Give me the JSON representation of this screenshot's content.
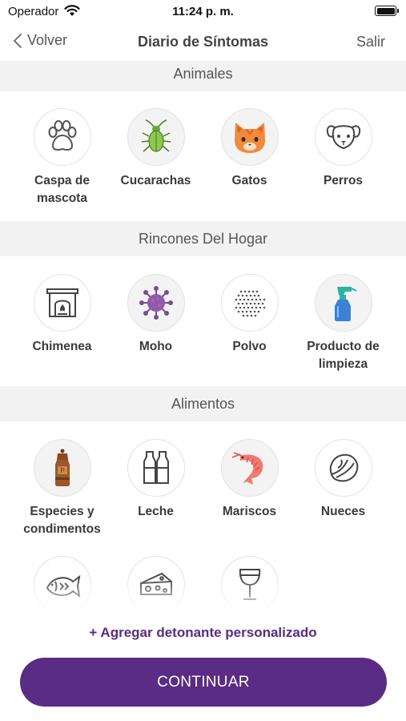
{
  "status": {
    "carrier": "Operador",
    "time": "11:24 p. m."
  },
  "nav": {
    "back_label": "Volver",
    "title": "Diario de Síntomas",
    "exit_label": "Salir"
  },
  "sections": [
    {
      "title": "Animales",
      "items": [
        {
          "label": "Caspa de mascota",
          "icon": "paw-icon"
        },
        {
          "label": "Cucarachas",
          "icon": "cockroach-icon"
        },
        {
          "label": "Gatos",
          "icon": "cat-icon"
        },
        {
          "label": "Perros",
          "icon": "dog-icon"
        }
      ]
    },
    {
      "title": "Rincones Del Hogar",
      "items": [
        {
          "label": "Chimenea",
          "icon": "fireplace-icon"
        },
        {
          "label": "Moho",
          "icon": "mold-icon"
        },
        {
          "label": "Polvo",
          "icon": "dust-icon"
        },
        {
          "label": "Producto de limpieza",
          "icon": "spray-bottle-icon"
        }
      ]
    },
    {
      "title": "Alimentos",
      "items": [
        {
          "label": "Especies y condimentos",
          "icon": "pepper-grinder-icon"
        },
        {
          "label": "Leche",
          "icon": "milk-bottles-icon"
        },
        {
          "label": "Mariscos",
          "icon": "shrimp-icon"
        },
        {
          "label": "Nueces",
          "icon": "nut-icon"
        },
        {
          "label": "",
          "icon": "fish-icon"
        },
        {
          "label": "",
          "icon": "cheese-icon"
        },
        {
          "label": "",
          "icon": "wine-glass-icon"
        }
      ]
    }
  ],
  "actions": {
    "add_trigger": "+ Agregar detonante personalizado",
    "continue": "CONTINUAR"
  },
  "colors": {
    "accent": "#5b2c86",
    "section_bg": "#f2f2f2"
  }
}
